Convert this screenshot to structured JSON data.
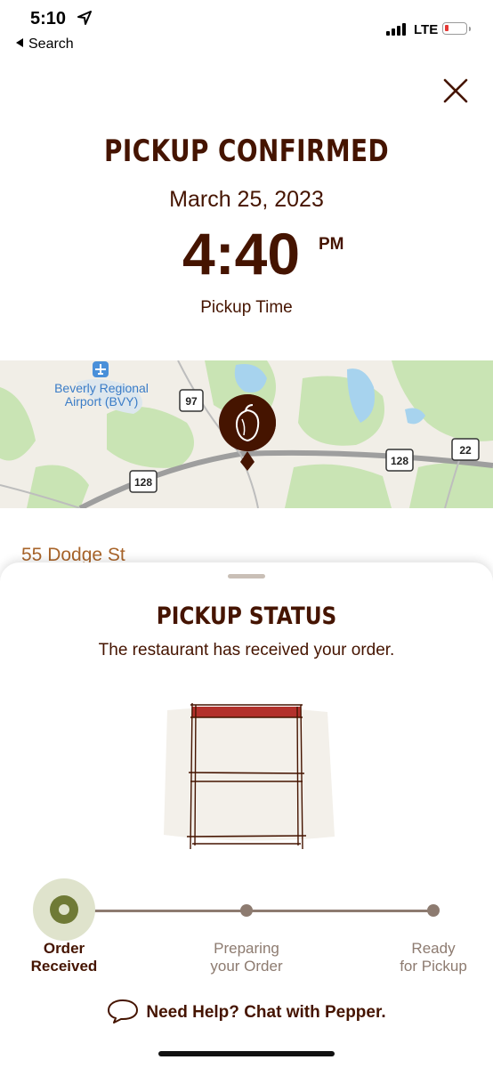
{
  "status_bar": {
    "time": "5:10",
    "back_label": "Search",
    "carrier": "LTE"
  },
  "header": {
    "title": "PICKUP CONFIRMED",
    "date": "March 25, 2023",
    "time": "4:40",
    "ampm": "PM",
    "time_label": "Pickup Time"
  },
  "map": {
    "airport_label_line1": "Beverly Regional",
    "airport_label_line2": "Airport (BVY)",
    "shields": [
      "97",
      "128",
      "128",
      "22"
    ]
  },
  "address": "55 Dodge St",
  "status_sheet": {
    "title": "PICKUP STATUS",
    "subtitle": "The restaurant has received your order.",
    "steps": [
      {
        "line1": "Order",
        "line2": "Received",
        "active": true
      },
      {
        "line1": "Preparing",
        "line2": "your Order",
        "active": false
      },
      {
        "line1": "Ready",
        "line2": "for Pickup",
        "active": false
      }
    ],
    "help_question": "Need Help?",
    "help_link": "Chat with Pepper."
  },
  "colors": {
    "brand_brown": "#451400",
    "address_orange": "#a8642a",
    "step_active": "#6f7a36",
    "step_inactive": "#8d7b70",
    "accent_red": "#b3312c"
  },
  "icons": [
    "location-arrow-icon",
    "back-arrow-icon",
    "signal-icon",
    "battery-icon",
    "close-icon",
    "airport-icon",
    "chipotle-pin-icon",
    "chat-bubble-icon"
  ]
}
